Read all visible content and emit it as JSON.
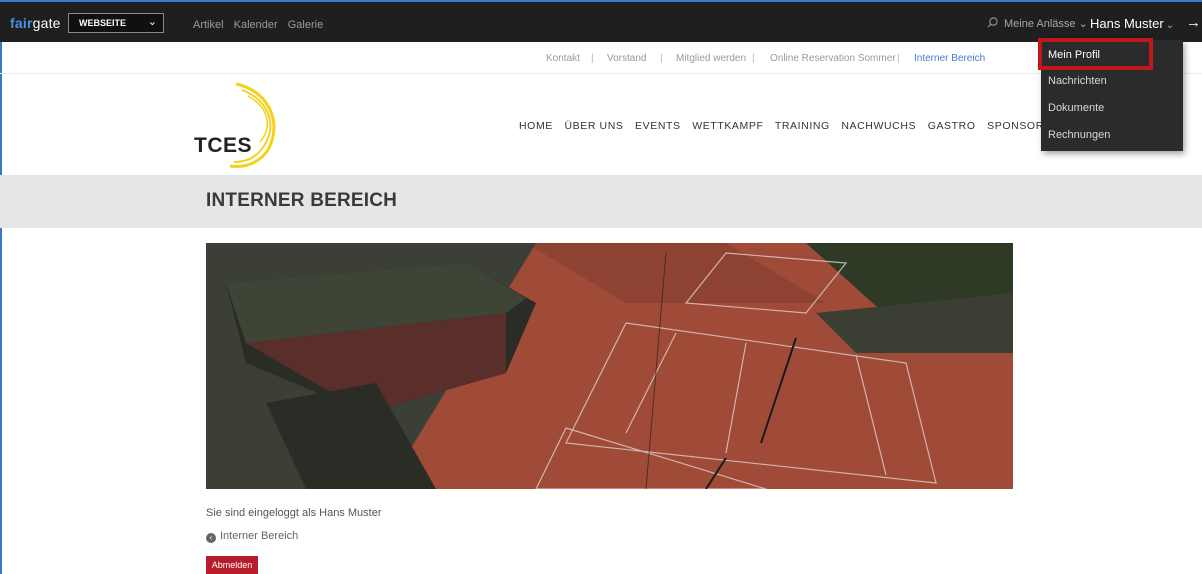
{
  "adminbar": {
    "brand_fair": "fair",
    "brand_gate": "gate",
    "site_select": "WEBSEITE",
    "nav": [
      "Artikel",
      "Kalender",
      "Galerie"
    ],
    "meine_anlaesse": "Meine Anlässe",
    "user_name": "Hans Muster"
  },
  "user_menu": {
    "items": [
      "Mein Profil",
      "Nachrichten",
      "Dokumente",
      "Rechnungen"
    ]
  },
  "metanav": {
    "items": [
      "Kontakt",
      "Vorstand",
      "Mitglied werden",
      "Online Reservation Sommer",
      "Interner Bereich"
    ],
    "separator": "|"
  },
  "logo": {
    "text": "TCES"
  },
  "mainnav": {
    "items": [
      "HOME",
      "ÜBER UNS",
      "EVENTS",
      "WETTKAMPF",
      "TRAINING",
      "NACHWUCHS",
      "GASTRO",
      "SPONSOREN"
    ]
  },
  "page": {
    "title": "INTERNER BEREICH",
    "logged_in_text": "Sie sind eingeloggt als Hans Muster",
    "back_link": "Interner Bereich",
    "logout_button": "Abmelden"
  },
  "colors": {
    "adminbar_bg": "#1f1f1f",
    "brand_blue": "#4a90e2",
    "active_link": "#4a7bd0",
    "logout_red": "#b71c2a",
    "highlight_red": "#c0161c",
    "court_clay": "#9c4535"
  }
}
